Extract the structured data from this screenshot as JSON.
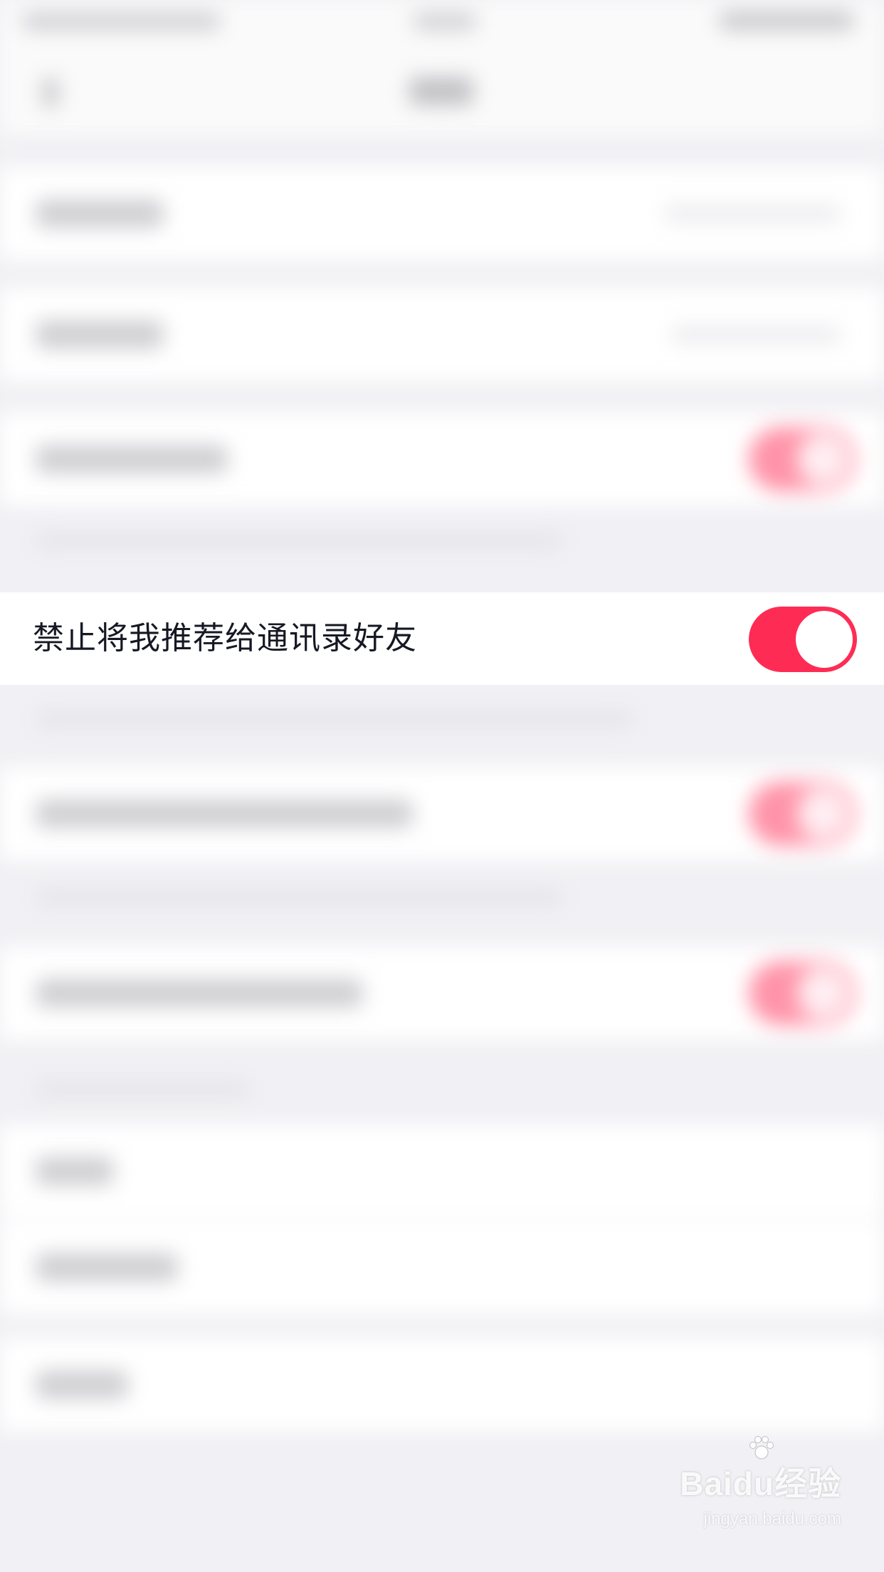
{
  "focused_setting": {
    "label": "禁止将我推荐给通讯录好友",
    "toggle_on": true
  },
  "colors": {
    "accent": "#fe2c55",
    "background": "#f1f1f5",
    "row_background": "#ffffff",
    "label_text": "#161823"
  },
  "watermark": {
    "logo_text": "Baidu经验",
    "url": "jingyan.baidu.com"
  }
}
